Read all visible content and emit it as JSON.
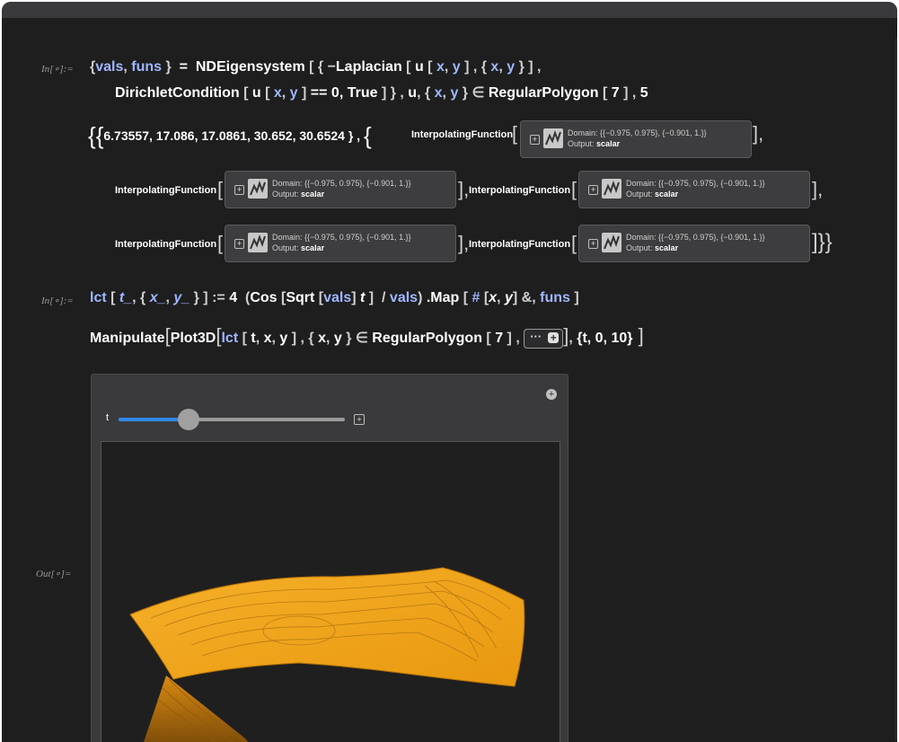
{
  "cells": {
    "in1": {
      "label": "In[∘]:=",
      "vals": "vals",
      "funs": "funs",
      "fn": "NDEigensystem",
      "laplacian": "Laplacian",
      "u": "u",
      "x": "x",
      "y": "y",
      "dirichlet": "DirichletCondition",
      "eq": "== 0, True",
      "region": "RegularPolygon",
      "seven": "7",
      "five": "5"
    },
    "out1": {
      "values": "6.73557, 17.086, 17.0861, 30.652, 30.6524",
      "interp_name": "InterpolatingFunction",
      "domain_text": "Domain: {{−0.975, 0.975}, {−0.901, 1.}}",
      "output_label": "Output:",
      "output_value": "scalar"
    },
    "in2": {
      "label": "In[∘]:=",
      "lct": "lct",
      "t": "t_",
      "x": "x_",
      "y": "y_",
      "four": "4",
      "cos": "Cos",
      "sqrt": "Sqrt",
      "vals": "vals",
      "tvar": "t",
      "map": ".Map",
      "slot": "#",
      "funs": "funs"
    },
    "manip": {
      "manipulate": "Manipulate",
      "plot3d": "Plot3D",
      "lct": "lct",
      "region": "RegularPolygon",
      "seven": "7",
      "range": "{t, 0, 10}",
      "ellipsis": "···",
      "plus": "+"
    },
    "out2": {
      "label": "Out[∘]=",
      "slider_label": "t",
      "slider_value_fraction": 0.31,
      "slider_min": 0,
      "slider_max": 10
    }
  },
  "colors": {
    "background": "#1e1e1f",
    "variable": "#9fb7ff",
    "slider_fill": "#2f8ae8",
    "surface": "#f5a623"
  },
  "icons": [
    "plus-icon",
    "interpolating-thumbnail-icon",
    "close-icon"
  ]
}
